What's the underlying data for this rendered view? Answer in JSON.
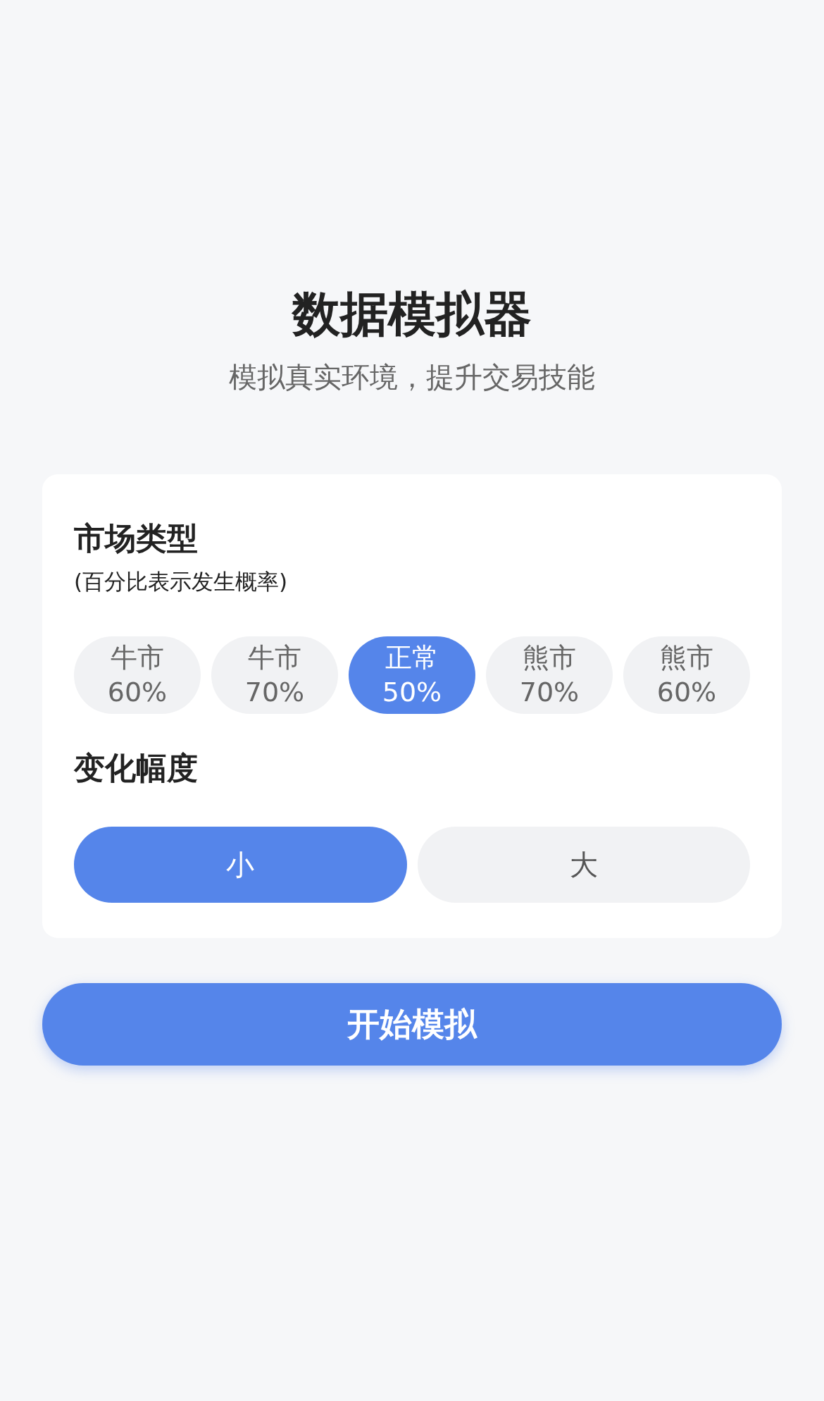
{
  "header": {
    "title": "数据模拟器",
    "subtitle": "模拟真实环境，提升交易技能"
  },
  "market": {
    "title": "市场类型",
    "note": "(百分比表示发生概率)",
    "options": [
      {
        "name": "牛市",
        "percent": "60%",
        "selected": false
      },
      {
        "name": "牛市",
        "percent": "70%",
        "selected": false
      },
      {
        "name": "正常",
        "percent": "50%",
        "selected": true
      },
      {
        "name": "熊市",
        "percent": "70%",
        "selected": false
      },
      {
        "name": "熊市",
        "percent": "60%",
        "selected": false
      }
    ]
  },
  "amplitude": {
    "title": "变化幅度",
    "options": [
      {
        "label": "小",
        "selected": true
      },
      {
        "label": "大",
        "selected": false
      }
    ]
  },
  "start_button": "开始模拟"
}
